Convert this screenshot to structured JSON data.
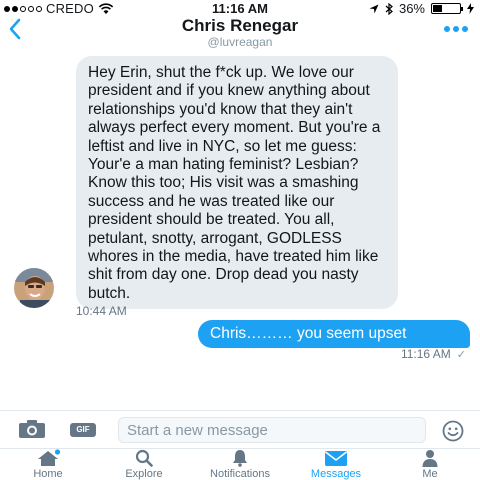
{
  "status_bar": {
    "carrier": "CREDO",
    "time": "11:16 AM",
    "battery": "36%",
    "battery_level": 0.36
  },
  "header": {
    "back_icon": "chevron-left-icon",
    "name": "Chris Renegar",
    "handle": "@luvreagan",
    "more_icon": "more-dots-icon"
  },
  "messages": [
    {
      "direction": "incoming",
      "text": "Hey Erin, shut the f*ck up.  We love our president and if you knew anything about relationships you'd know that they ain't always perfect every moment.  But you're a leftist and live in NYC, so let me guess: Your'e a man hating feminist? Lesbian?  Know this too; His visit was a smashing success and he was treated like our president should be treated. You all, petulant, snotty, arrogant, GODLESS whores in the media, have treated him like shit from day one. Drop dead you nasty butch.",
      "time": "10:44 AM"
    },
    {
      "direction": "outgoing",
      "text": "Chris……… you seem upset",
      "time": "11:16 AM"
    }
  ],
  "composer": {
    "camera_icon": "camera-icon",
    "gif_label": "GIF",
    "placeholder": "Start a new message",
    "emoji_icon": "emoji-icon"
  },
  "tabs": [
    {
      "label": "Home",
      "icon": "home-icon"
    },
    {
      "label": "Explore",
      "icon": "search-icon"
    },
    {
      "label": "Notifications",
      "icon": "bell-icon"
    },
    {
      "label": "Messages",
      "icon": "envelope-icon",
      "active": true
    },
    {
      "label": "Me",
      "icon": "person-icon"
    }
  ],
  "colors": {
    "accent": "#1da1f2",
    "incoming_bubble": "#e6ecf0",
    "muted_text": "#657786"
  }
}
